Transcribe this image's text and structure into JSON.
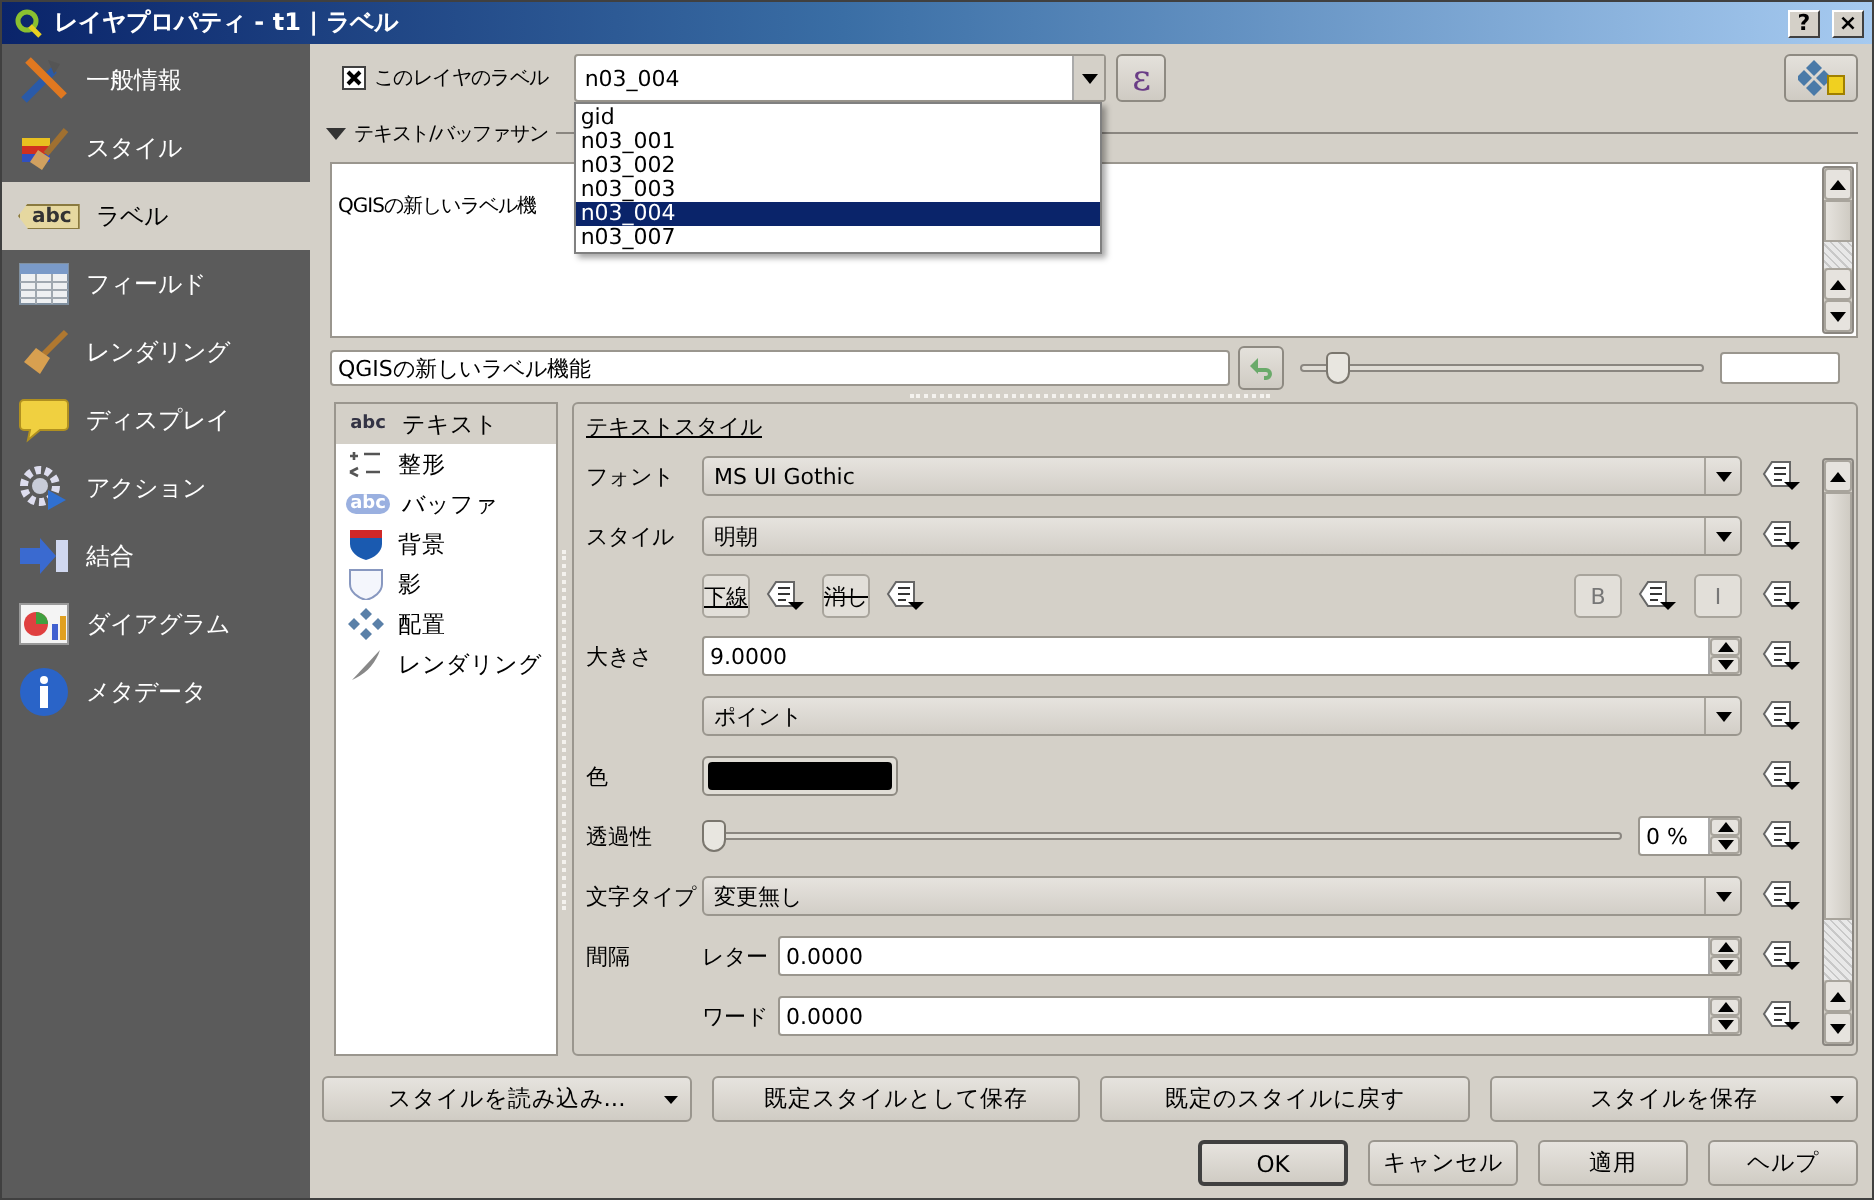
{
  "window": {
    "title": "レイヤプロパティ - t1 | ラベル",
    "buttons": [
      "?",
      "×"
    ]
  },
  "sidebar": {
    "items": [
      {
        "label": "一般情報",
        "selected": false
      },
      {
        "label": "スタイル",
        "selected": false
      },
      {
        "label": "ラベル",
        "selected": true,
        "icon_text": "abc"
      },
      {
        "label": "フィールド",
        "selected": false
      },
      {
        "label": "レンダリング",
        "selected": false
      },
      {
        "label": "ディスプレイ",
        "selected": false
      },
      {
        "label": "アクション",
        "selected": false
      },
      {
        "label": "結合",
        "selected": false
      },
      {
        "label": "ダイアグラム",
        "selected": false
      },
      {
        "label": "メタデータ",
        "selected": false
      }
    ]
  },
  "label_toggle": {
    "label": "このレイヤのラベル",
    "checked": true
  },
  "field_combo": {
    "value": "n03_004",
    "options": [
      {
        "label": "gid",
        "selected": false
      },
      {
        "label": "n03_001",
        "selected": false
      },
      {
        "label": "n03_002",
        "selected": false
      },
      {
        "label": "n03_003",
        "selected": false
      },
      {
        "label": "n03_004",
        "selected": true
      },
      {
        "label": "n03_007",
        "selected": false
      }
    ]
  },
  "expression_button": {
    "label": "ε"
  },
  "section": {
    "title": "テキスト/バッファサン",
    "expanded": true
  },
  "preview": {
    "text": "QGISの新しいラベル機",
    "sample_text": "QGISの新しいラベル機能",
    "level": 0.07
  },
  "tabs": [
    {
      "label": "テキスト",
      "selected": true,
      "icon_text": "abc"
    },
    {
      "label": "整形",
      "selected": false
    },
    {
      "label": "バッファ",
      "selected": false,
      "icon_text": "abc"
    },
    {
      "label": "背景",
      "selected": false
    },
    {
      "label": "影",
      "selected": false
    },
    {
      "label": "配置",
      "selected": false
    },
    {
      "label": "レンダリング",
      "selected": false
    }
  ],
  "text_style": {
    "title": "テキストスタイル",
    "rows": [
      {
        "kind": "combo",
        "label": "フォント",
        "value": "MS UI Gothic"
      },
      {
        "kind": "combo",
        "label": "スタイル",
        "value": "明朝"
      },
      {
        "kind": "toggles",
        "buttons": [
          {
            "label": "下線",
            "kind": "underline"
          },
          {
            "label": "消し",
            "kind": "strike"
          }
        ],
        "right_buttons": [
          "B",
          "I"
        ]
      },
      {
        "kind": "spin",
        "label": "大きさ",
        "value": "9.0000"
      },
      {
        "kind": "combo",
        "value": "ポイント"
      },
      {
        "kind": "color",
        "label": "色",
        "color": "#000000"
      },
      {
        "kind": "slider",
        "label": "透過性",
        "level": 0,
        "reading": "0 %"
      },
      {
        "kind": "combo",
        "label": "文字タイプ",
        "value": "変更無し"
      },
      {
        "kind": "spin",
        "label": "間隔",
        "sublabel": "レター",
        "value": "0.0000"
      },
      {
        "kind": "spin",
        "sublabel": "ワード",
        "value": "0.0000"
      }
    ]
  },
  "style_buttons": [
    {
      "label": "スタイルを読み込み...",
      "menu": true
    },
    {
      "label": "既定スタイルとして保存",
      "menu": false
    },
    {
      "label": "既定のスタイルに戻す",
      "menu": false
    },
    {
      "label": "スタイルを保存",
      "menu": true
    }
  ],
  "dialog_buttons": [
    {
      "label": "OK",
      "default": true
    },
    {
      "label": "キャンセル",
      "default": false
    },
    {
      "label": "適用",
      "default": false
    },
    {
      "label": "ヘルプ",
      "default": false
    }
  ]
}
